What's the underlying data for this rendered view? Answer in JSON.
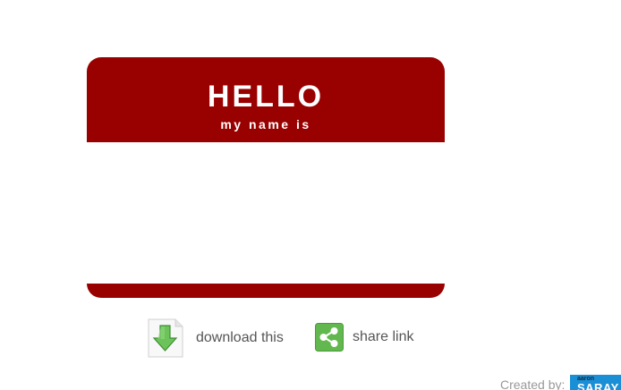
{
  "badge": {
    "greeting": "HELLO",
    "subtitle": "my name is",
    "name": ""
  },
  "actions": {
    "download_label": "download this",
    "share_label": "share link"
  },
  "footer": {
    "created_by_label": "Created by:",
    "logo_small": "aaron",
    "logo_main": "SARAY"
  },
  "colors": {
    "badge_red": "#990000",
    "download_green": "#5fb04f",
    "share_green": "#62b84e",
    "logo_blue": "#1a8fd6"
  },
  "icons": {
    "download": "download-document-icon",
    "share": "share-icon"
  }
}
